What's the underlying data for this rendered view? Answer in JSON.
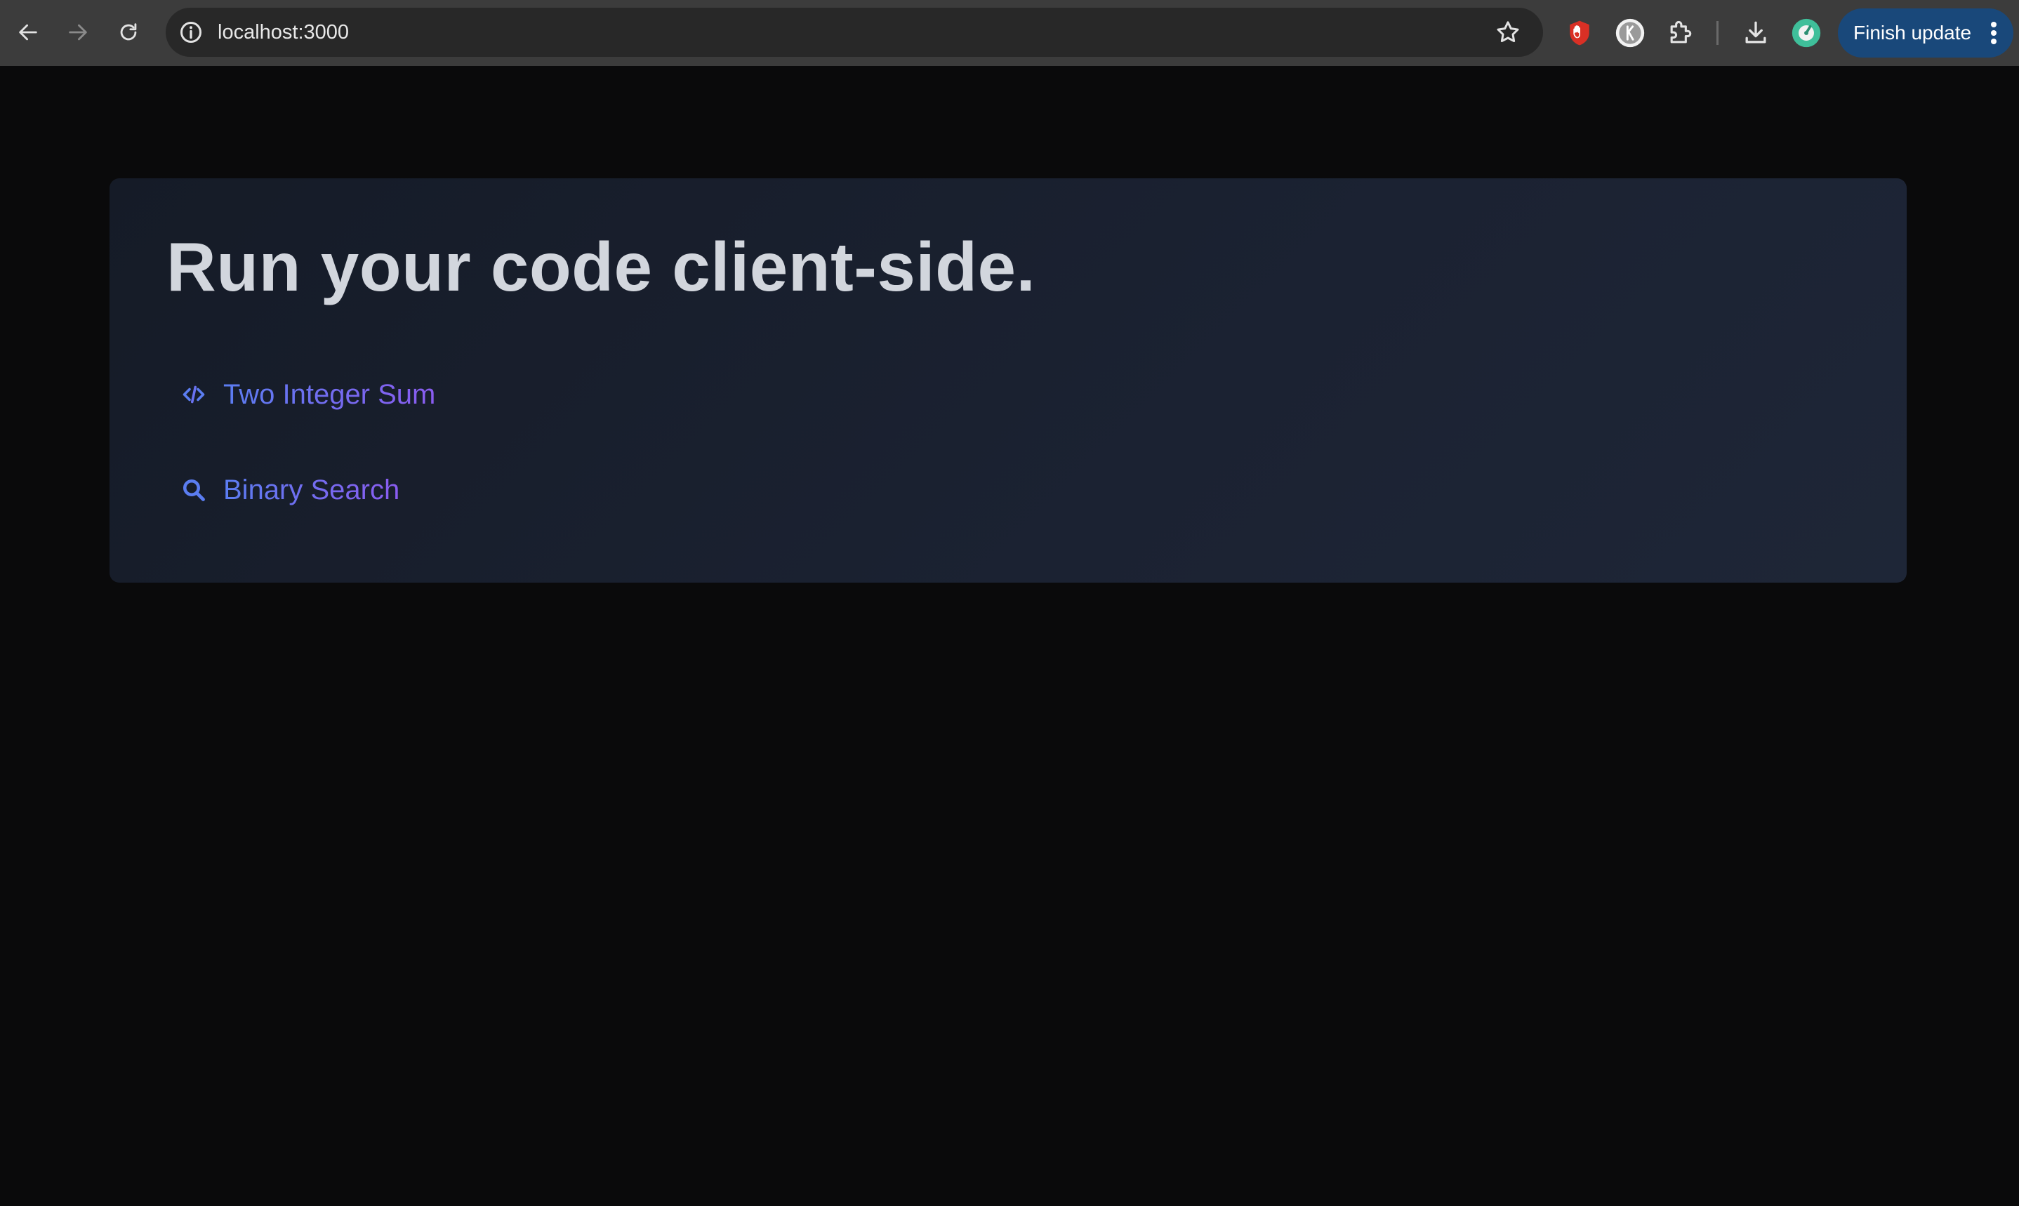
{
  "browser": {
    "url": "localhost:3000",
    "finish_update_label": "Finish update",
    "icons": {
      "back": "back-arrow-icon",
      "forward": "forward-arrow-icon",
      "reload": "reload-icon",
      "site_info": "info-icon",
      "bookmark": "star-icon",
      "extension_1": "hand-stop-icon",
      "extension_2": "profile-circle-icon",
      "extensions": "puzzle-icon",
      "downloads": "download-icon",
      "extension_3": "green-circle-icon",
      "menu": "kebab-menu-icon"
    },
    "colors": {
      "toolbar": "#3c3c3c",
      "omnibox": "#282828",
      "finish_update": "#19487a"
    }
  },
  "page": {
    "heading": "Run your code client-side.",
    "links": [
      {
        "label": "Two Integer Sum",
        "icon": "code-icon"
      },
      {
        "label": "Binary Search",
        "icon": "search-icon"
      }
    ],
    "colors": {
      "background": "#0a0a0b",
      "card": "#1b2232",
      "heading": "#d2d6dd",
      "link_gradient_start": "#5b7df1",
      "link_gradient_end": "#8a5cf0"
    }
  }
}
